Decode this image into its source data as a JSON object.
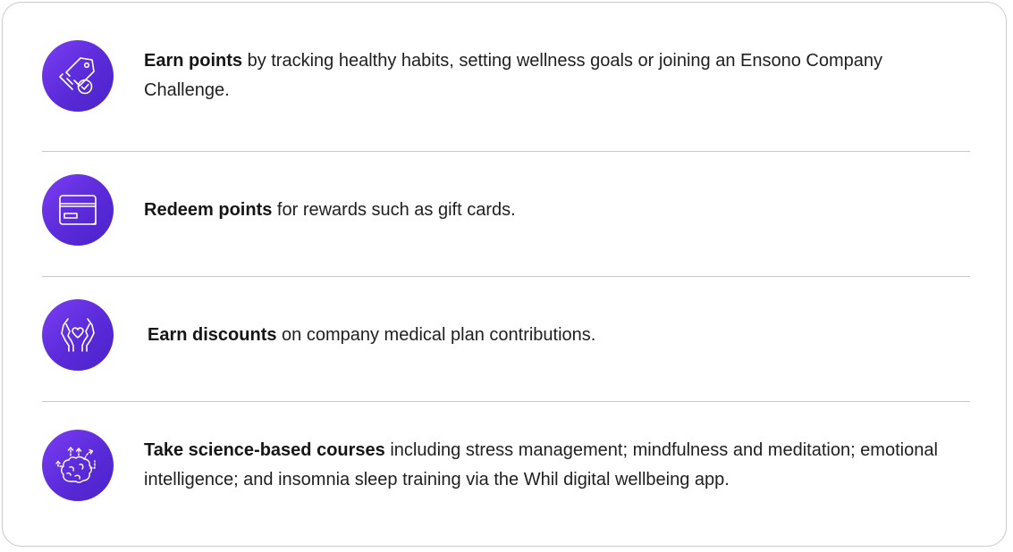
{
  "items": [
    {
      "icon": "tag-check-icon",
      "bold": "Earn points",
      "rest": " by tracking healthy habits, setting wellness goals or joining an Ensono Company Challenge."
    },
    {
      "icon": "credit-card-icon",
      "bold": "Redeem points",
      "rest": " for rewards such as gift cards."
    },
    {
      "icon": "hands-heart-icon",
      "bold": "Earn discounts",
      "rest": " on company medical plan contributions."
    },
    {
      "icon": "brain-arrows-icon",
      "bold": "Take science-based courses",
      "rest": " including stress management; mindfulness and meditation; emotional intelligence; and insomnia sleep training via the Whil digital wellbeing app."
    }
  ],
  "colors": {
    "icon_gradient_start": "#7a3ef2",
    "icon_gradient_end": "#4a23c8",
    "border": "#c9c9cf",
    "text": "#1f1f22"
  }
}
